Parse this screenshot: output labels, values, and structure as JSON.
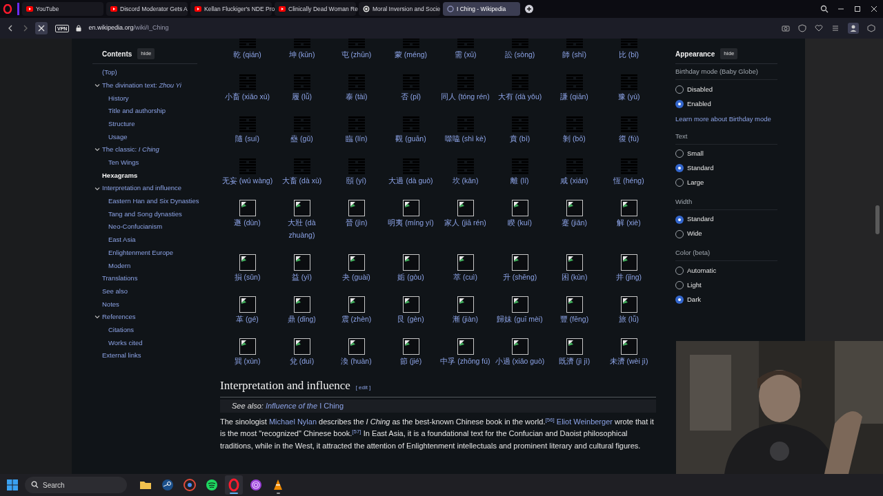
{
  "browser": {
    "tabs": [
      {
        "title": "YouTube",
        "kind": "youtube",
        "selected": false
      },
      {
        "title": "Discord Moderator Gets A",
        "kind": "youtube",
        "selected": false
      },
      {
        "title": "Kellan Fluckiger's NDE Pro",
        "kind": "youtube",
        "selected": false
      },
      {
        "title": "Clinically Dead Woman Re",
        "kind": "youtube",
        "selected": false
      },
      {
        "title": "Moral Inversion and Socie",
        "kind": "chat",
        "selected": false
      },
      {
        "title": "I Ching - Wikipedia",
        "kind": "loading",
        "selected": true
      }
    ],
    "vpn": "VPN",
    "url": {
      "host": "en.wikipedia.org",
      "path": "/wiki/I_Ching"
    }
  },
  "toc": {
    "title": "Contents",
    "hide": "hide",
    "items": [
      {
        "label": "(Top)",
        "selected": false
      },
      {
        "label": "The divination text: *Zhou Yi*",
        "expanded": true,
        "selected": false,
        "children": [
          {
            "label": "History",
            "selected": false
          },
          {
            "label": "Title and authorship",
            "selected": false
          },
          {
            "label": "Structure",
            "selected": false
          },
          {
            "label": "Usage",
            "selected": false
          }
        ]
      },
      {
        "label": "The classic: *I Ching*",
        "expanded": true,
        "selected": false,
        "children": [
          {
            "label": "Ten Wings",
            "selected": false
          }
        ]
      },
      {
        "label": "Hexagrams",
        "selected": true
      },
      {
        "label": "Interpretation and influence",
        "expanded": true,
        "selected": false,
        "children": [
          {
            "label": "Eastern Han and Six Dynasties",
            "selected": false
          },
          {
            "label": "Tang and Song dynasties",
            "selected": false
          },
          {
            "label": "Neo-Confucianism",
            "selected": false
          },
          {
            "label": "East Asia",
            "selected": false
          },
          {
            "label": "Enlightenment Europe",
            "selected": false
          },
          {
            "label": "Modern",
            "selected": false
          }
        ]
      },
      {
        "label": "Translations",
        "selected": false
      },
      {
        "label": "See also",
        "selected": false
      },
      {
        "label": "Notes",
        "selected": false
      },
      {
        "label": "References",
        "expanded": true,
        "selected": false,
        "children": [
          {
            "label": "Citations",
            "selected": false
          },
          {
            "label": "Works cited",
            "selected": false
          }
        ]
      },
      {
        "label": "External links",
        "selected": false
      }
    ]
  },
  "hexagrams": [
    {
      "label": "乾 (qián)",
      "kind": "glyph"
    },
    {
      "label": "坤 (kūn)",
      "kind": "glyph"
    },
    {
      "label": "屯 (zhūn)",
      "kind": "glyph"
    },
    {
      "label": "蒙 (méng)",
      "kind": "glyph"
    },
    {
      "label": "需 (xū)",
      "kind": "glyph"
    },
    {
      "label": "訟 (sòng)",
      "kind": "glyph"
    },
    {
      "label": "師 (shī)",
      "kind": "glyph"
    },
    {
      "label": "比 (bǐ)",
      "kind": "glyph"
    },
    {
      "label": "小畜 (xiǎo xù)",
      "kind": "glyph"
    },
    {
      "label": "履 (lǚ)",
      "kind": "glyph"
    },
    {
      "label": "泰 (tài)",
      "kind": "glyph"
    },
    {
      "label": "否 (pǐ)",
      "kind": "glyph"
    },
    {
      "label": "同人 (tóng rén)",
      "kind": "glyph"
    },
    {
      "label": "大有 (dà yǒu)",
      "kind": "glyph"
    },
    {
      "label": "謙 (qiān)",
      "kind": "glyph"
    },
    {
      "label": "豫 (yù)",
      "kind": "glyph"
    },
    {
      "label": "隨 (suí)",
      "kind": "glyph"
    },
    {
      "label": "蠱 (gǔ)",
      "kind": "glyph"
    },
    {
      "label": "臨 (lín)",
      "kind": "glyph"
    },
    {
      "label": "觀 (guān)",
      "kind": "glyph"
    },
    {
      "label": "噬嗑 (shì kè)",
      "kind": "glyph"
    },
    {
      "label": "賁 (bì)",
      "kind": "glyph"
    },
    {
      "label": "剝 (bō)",
      "kind": "glyph"
    },
    {
      "label": "復 (fù)",
      "kind": "glyph"
    },
    {
      "label": "无妄 (wú wàng)",
      "kind": "glyph"
    },
    {
      "label": "大畜 (dà xù)",
      "kind": "glyph"
    },
    {
      "label": "頤 (yí)",
      "kind": "glyph"
    },
    {
      "label": "大過 (dà guò)",
      "kind": "glyph"
    },
    {
      "label": "坎 (kǎn)",
      "kind": "glyph"
    },
    {
      "label": "離 (lí)",
      "kind": "glyph"
    },
    {
      "label": "咸 (xián)",
      "kind": "glyph"
    },
    {
      "label": "恆 (héng)",
      "kind": "glyph"
    },
    {
      "label": "遯 (dùn)",
      "kind": "broken_image"
    },
    {
      "label": "大壯 (dà zhuàng)",
      "kind": "broken_image"
    },
    {
      "label": "晉 (jìn)",
      "kind": "broken_image"
    },
    {
      "label": "明夷 (míng yí)",
      "kind": "broken_image"
    },
    {
      "label": "家人 (jiā rén)",
      "kind": "broken_image"
    },
    {
      "label": "睽 (kuí)",
      "kind": "broken_image"
    },
    {
      "label": "蹇 (jiǎn)",
      "kind": "broken_image"
    },
    {
      "label": "解 (xiè)",
      "kind": "broken_image"
    },
    {
      "label": "損 (sǔn)",
      "kind": "broken_image"
    },
    {
      "label": "益 (yì)",
      "kind": "broken_image"
    },
    {
      "label": "夬 (guài)",
      "kind": "broken_image"
    },
    {
      "label": "姤 (gòu)",
      "kind": "broken_image"
    },
    {
      "label": "萃 (cuì)",
      "kind": "broken_image"
    },
    {
      "label": "升 (shēng)",
      "kind": "broken_image"
    },
    {
      "label": "困 (kùn)",
      "kind": "broken_image"
    },
    {
      "label": "井 (jǐng)",
      "kind": "broken_image"
    },
    {
      "label": "革 (gé)",
      "kind": "broken_image"
    },
    {
      "label": "鼎 (dǐng)",
      "kind": "broken_image"
    },
    {
      "label": "震 (zhèn)",
      "kind": "broken_image"
    },
    {
      "label": "艮 (gèn)",
      "kind": "broken_image"
    },
    {
      "label": "漸 (jiàn)",
      "kind": "broken_image"
    },
    {
      "label": "歸妹 (guī mèi)",
      "kind": "broken_image"
    },
    {
      "label": "豐 (fēng)",
      "kind": "broken_image"
    },
    {
      "label": "旅 (lǚ)",
      "kind": "broken_image"
    },
    {
      "label": "巽 (xùn)",
      "kind": "broken_image"
    },
    {
      "label": "兌 (duì)",
      "kind": "broken_image"
    },
    {
      "label": "渙 (huàn)",
      "kind": "broken_image"
    },
    {
      "label": "節 (jié)",
      "kind": "broken_image"
    },
    {
      "label": "中孚 (zhōng fú)",
      "kind": "broken_image"
    },
    {
      "label": "小過 (xiǎo guò)",
      "kind": "broken_image"
    },
    {
      "label": "既濟 (jì jì)",
      "kind": "broken_image"
    },
    {
      "label": "未濟 (wèi jì)",
      "kind": "broken_image"
    }
  ],
  "section": {
    "heading": "Interpretation and influence",
    "edit": {
      "open": "[",
      "label": "edit",
      "close": "]"
    },
    "see_also": {
      "prefix": "See also:",
      "link": "*Influence of the* I Ching"
    },
    "paragraph": [
      {
        "kind": "text",
        "text": "The sinologist "
      },
      {
        "kind": "link",
        "text": "Michael Nylan"
      },
      {
        "kind": "text",
        "text": " describes the *I Ching* as the best-known Chinese book in the world."
      },
      {
        "kind": "ref",
        "text": "[56]"
      },
      {
        "kind": "link",
        "text": "Eliot Weinberger"
      },
      {
        "kind": "text",
        "text": " wrote that it is the most \"recognized\" Chinese book."
      },
      {
        "kind": "ref",
        "text": "[57]"
      },
      {
        "kind": "text",
        "text": " In East Asia, it is a foundational text for the Confucian and Daoist philosophical traditions, while in the West, it attracted the attention of Enlightenment intellectuals and prominent literary and cultural figures."
      }
    ]
  },
  "appearance": {
    "title": "Appearance",
    "hide": "hide",
    "groups": [
      {
        "label": "Birthday mode (Baby Globe)",
        "options": [
          {
            "label": "Disabled",
            "selected": false
          },
          {
            "label": "Enabled",
            "selected": true
          }
        ],
        "link": "Learn more about Birthday mode"
      },
      {
        "label": "Text",
        "options": [
          {
            "label": "Small",
            "selected": false
          },
          {
            "label": "Standard",
            "selected": true
          },
          {
            "label": "Large",
            "selected": false
          }
        ]
      },
      {
        "label": "Width",
        "options": [
          {
            "label": "Standard",
            "selected": true
          },
          {
            "label": "Wide",
            "selected": false
          }
        ]
      },
      {
        "label": "Color (beta)",
        "options": [
          {
            "label": "Automatic",
            "selected": false
          },
          {
            "label": "Light",
            "selected": false
          },
          {
            "label": "Dark",
            "selected": true
          }
        ]
      }
    ]
  },
  "taskbar": {
    "search": {
      "placeholder": "Search"
    },
    "apps": [
      {
        "kind": "files",
        "running": false,
        "selected": false
      },
      {
        "kind": "steam",
        "running": false,
        "selected": false
      },
      {
        "kind": "chrome",
        "running": false,
        "selected": false
      },
      {
        "kind": "spotify",
        "running": false,
        "selected": false
      },
      {
        "kind": "opera",
        "running": true,
        "selected": true
      },
      {
        "kind": "tor",
        "running": false,
        "selected": false
      },
      {
        "kind": "vlc",
        "running": true,
        "selected": false
      }
    ]
  }
}
